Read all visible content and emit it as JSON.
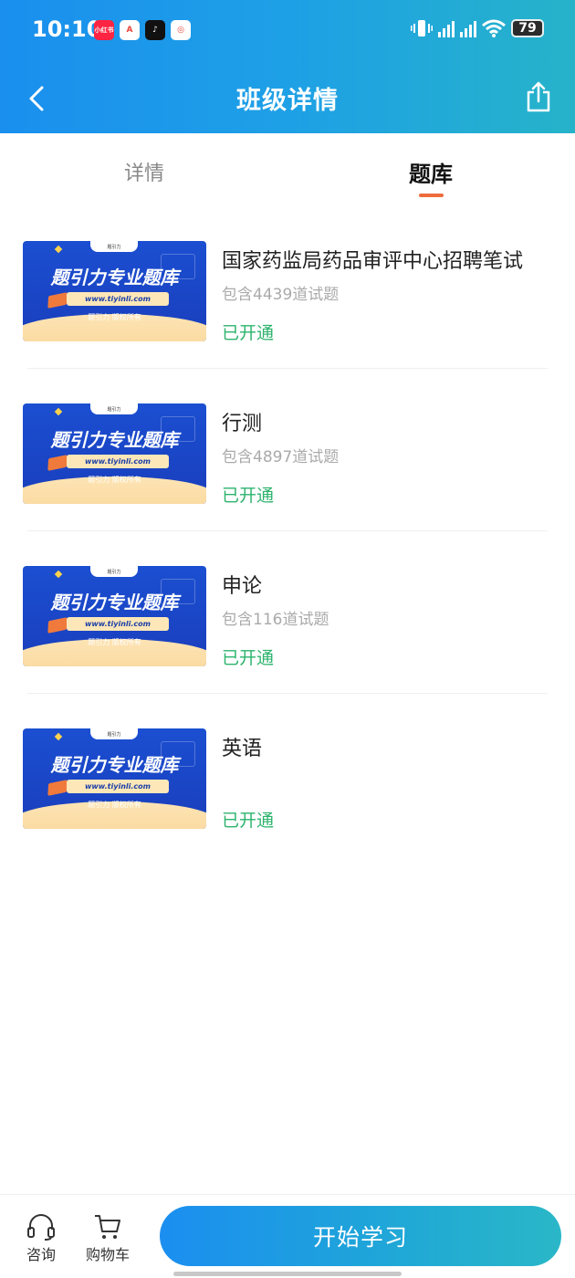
{
  "status_bar": {
    "time": "10:10",
    "battery": "79",
    "apps": [
      {
        "name": "xiaohongshu-app-icon",
        "label": "小红书",
        "color": "#ff2442"
      },
      {
        "name": "app-a-icon",
        "label": "A",
        "color": "#e8463e"
      },
      {
        "name": "tiktok-app-icon",
        "label": "♪",
        "color": "#111111"
      },
      {
        "name": "app-red-icon",
        "label": "◎",
        "color": "#e8463e"
      }
    ]
  },
  "header": {
    "title": "班级详情"
  },
  "tabs": [
    {
      "label": "详情",
      "active": false
    },
    {
      "label": "题库",
      "active": true
    }
  ],
  "thumbnail": {
    "banner_text": "题引力专业题库",
    "url_text": "www.tiyinli.com",
    "copyright": "题引力 版权所有",
    "brand": "题引力"
  },
  "items": [
    {
      "title": "国家药监局药品审评中心招聘笔试",
      "count": "包含4439道试题",
      "status": "已开通"
    },
    {
      "title": "行测",
      "count": "包含4897道试题",
      "status": "已开通"
    },
    {
      "title": "申论",
      "count": "包含116道试题",
      "status": "已开通"
    },
    {
      "title": "英语",
      "count": "",
      "status": "已开通"
    }
  ],
  "bottom_bar": {
    "consult_label": "咨询",
    "cart_label": "购物车",
    "start_label": "开始学习"
  },
  "colors": {
    "header_gradient_start": "#1a8fee",
    "header_gradient_end": "#26b3c9",
    "active_tab_indicator": "#ef6c3d",
    "status_opened": "#2db36d"
  }
}
